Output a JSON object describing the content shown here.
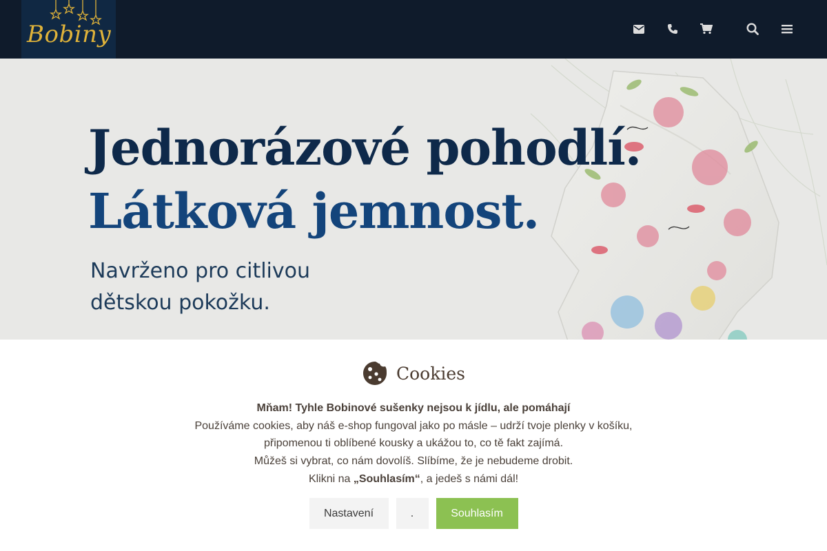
{
  "header": {
    "logo_text": "Bobiny",
    "icons": [
      "envelope-icon",
      "phone-icon",
      "cart-icon",
      "search-icon",
      "menu-icon"
    ]
  },
  "hero": {
    "title_line1": "Jednorázové pohodlí.",
    "title_line2": "Látková jemnost.",
    "subtitle_line1": "Navrženo pro citlivou",
    "subtitle_line2": "dětskou pokožku."
  },
  "cookie": {
    "title": "Cookies",
    "line1_icon_left": "",
    "line1_bold": "Mňam! Tyhle Bobinové sušenky nejsou k jídlu, ale pomáhají",
    "line1_icon_right": "",
    "line2": "Používáme cookies, aby náš e-shop fungoval jako po másle – udrží tvoje plenky v košíku,",
    "line3": "připomenou ti oblíbené kousky a ukážou to, co tě fakt zajímá.",
    "line4": "Můžeš si vybrat, co nám dovolíš. Slíbíme, že je nebudeme drobit. ",
    "line5_prefix": " Klikni na ",
    "line5_bold": "„Souhlasím“",
    "line5_suffix": ", a jedeš s námi dál!",
    "buttons": {
      "settings": "Nastavení",
      "dot": ".",
      "accept": "Souhlasím"
    }
  },
  "colors": {
    "header_bg": "#0f1b2b",
    "logo_gold": "#e0b33a",
    "title_navy": "#0e2a4c",
    "accept_green": "#8cc152"
  }
}
